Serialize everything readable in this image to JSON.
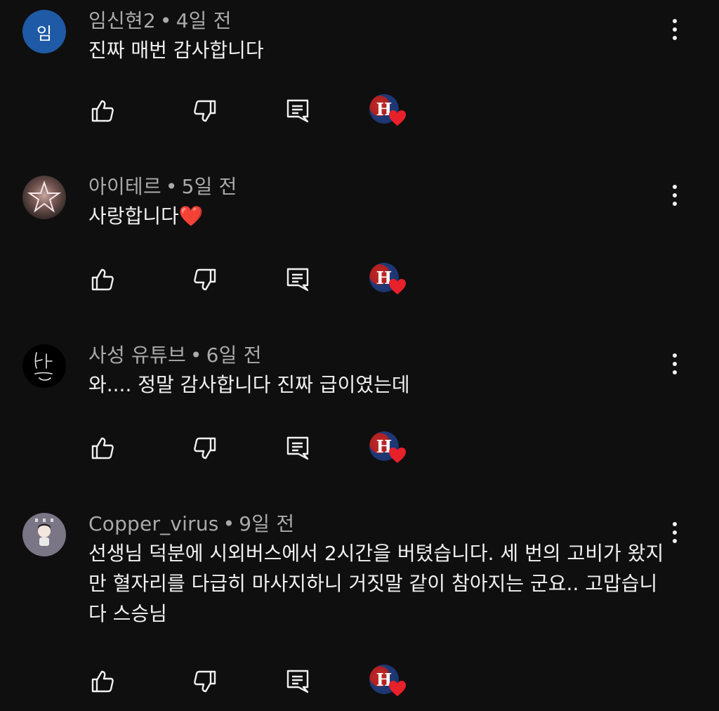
{
  "colors": {
    "background": "#0f0f0f",
    "meta_text": "#aaaaaa",
    "body_text": "#f1f1f1",
    "heart": "#e8202a"
  },
  "icons": {
    "like": "thumbs-up-icon",
    "dislike": "thumbs-down-icon",
    "reply": "comment-icon",
    "more": "more-vert-icon",
    "creator_heart": "creator-heart-icon"
  },
  "creator_badge_letter": "H",
  "comments": [
    {
      "avatar_letter": "임",
      "author": "임신현2",
      "separator": "•",
      "time": "4일 전",
      "text": "진짜 매번 감사합니다"
    },
    {
      "avatar_letter": "",
      "author": "아이테르",
      "separator": "•",
      "time": "5일 전",
      "text": "사랑합니다❤️"
    },
    {
      "avatar_letter": "",
      "author": "사성 유튜브",
      "separator": "•",
      "time": "6일 전",
      "text": "와.... 정말 감사합니다 진짜 급이였는데"
    },
    {
      "avatar_letter": "",
      "author": "Copper_virus",
      "separator": "•",
      "time": "9일 전",
      "text": "선생님 덕분에 시외버스에서 2시간을 버텼습니다. 세 번의 고비가 왔지만 혈자리를 다급히 마사지하니 거짓말 같이 참아지는 군요.. 고맙습니다 스승님"
    }
  ]
}
